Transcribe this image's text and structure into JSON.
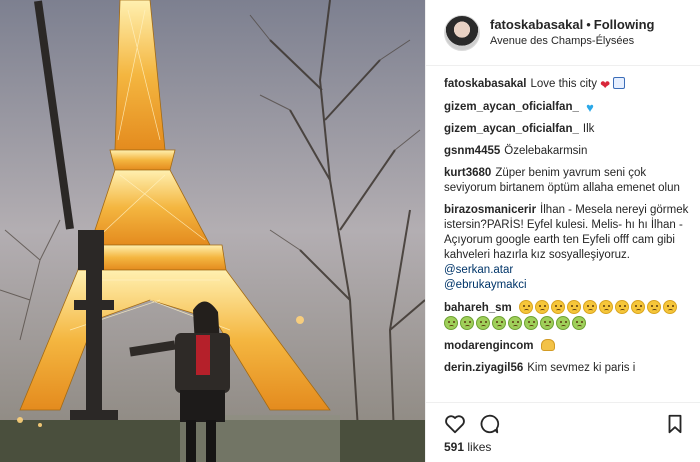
{
  "header": {
    "username": "fatoskabasakal",
    "separator": "•",
    "follow_status": "Following",
    "location": "Avenue des Champs-Élysées"
  },
  "comments": [
    {
      "user": "fatoskabasakal",
      "text": "Love this city",
      "icons": [
        "red-heart-icon",
        "ticket-icon"
      ]
    },
    {
      "user": "gizem_aycan_oficialfan_",
      "text": "",
      "icons": [
        "blue-heart-icon"
      ]
    },
    {
      "user": "gizem_aycan_oficialfan_",
      "text": "Ilk"
    },
    {
      "user": "gsnm4455",
      "text": "Özelebakarmsin"
    },
    {
      "user": "kurt3680",
      "text": "Züper benim yavrum seni çok seviyorum birtanem öptüm allaha emenet olun"
    },
    {
      "user": "birazosmanicerir",
      "text": "İlhan - Mesela nereyi görmek istersin?PARİS! Eyfel kulesi. Melis- hı hı İlhan - Açıyorum google earth ten Eyfeli offf cam gibi kahveleri hazırla kız sosyalleşiyoruz.",
      "mentions": [
        "@serkan.atar",
        "@ebrukaymakci"
      ]
    },
    {
      "user": "bahareh_sm",
      "text": "",
      "faces": 19
    },
    {
      "user": "modarengincom",
      "text": "",
      "icons": [
        "clapping-hands-icon"
      ]
    },
    {
      "user": "derin.ziyagil56",
      "text": "Kim sevmez ki paris i"
    }
  ],
  "actions": {
    "like_icon": "heart-outline-icon",
    "comment_icon": "comment-bubble-icon",
    "save_icon": "bookmark-icon"
  },
  "likes": {
    "count": "591",
    "label": "likes"
  },
  "colors": {
    "text": "#262626",
    "mention": "#003569",
    "border": "#efefef",
    "tower_light": "#f2b33d"
  }
}
